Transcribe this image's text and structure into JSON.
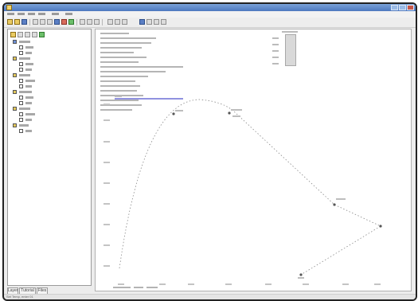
{
  "tabs": [
    {
      "label": "Layer"
    },
    {
      "label": "Tutorial"
    },
    {
      "label": "Files"
    }
  ],
  "status": {
    "text": "Set Temp, enter 01"
  },
  "colors": {
    "titlebar": "#4e79bf",
    "series_line": "#5a5a5a",
    "highlight_segment": "#6b6fd6"
  }
}
